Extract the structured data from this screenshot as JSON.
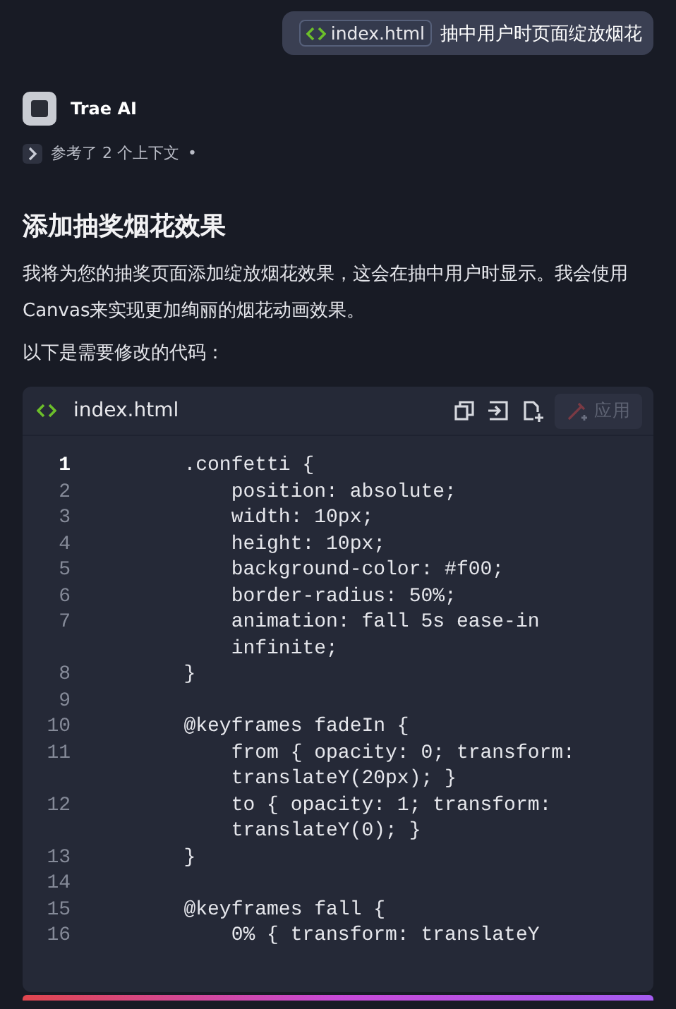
{
  "user_message": {
    "file_chip": "index.html",
    "text": "抽中用户时页面绽放烟花"
  },
  "assistant": {
    "name": "Trae AI",
    "context_note": "参考了 2 个上下文",
    "context_dot": "•"
  },
  "heading": "添加抽奖烟花效果",
  "paragraphs": [
    "我将为您的抽奖页面添加绽放烟花效果，这会在抽中用户时显示。我会使用Canvas来实现更加绚丽的烟花动画效果。",
    "以下是需要修改的代码："
  ],
  "code_block": {
    "filename": "index.html",
    "apply_label": "应用",
    "apply_disabled": true,
    "lines": [
      {
        "number": "1",
        "current": true,
        "text": "        .confetti {"
      },
      {
        "number": "2",
        "current": false,
        "text": "            position: absolute;"
      },
      {
        "number": "3",
        "current": false,
        "text": "            width: 10px;"
      },
      {
        "number": "4",
        "current": false,
        "text": "            height: 10px;"
      },
      {
        "number": "5",
        "current": false,
        "text": "            background-color: #f00;"
      },
      {
        "number": "6",
        "current": false,
        "text": "            border-radius: 50%;"
      },
      {
        "number": "7",
        "current": false,
        "text": "            animation: fall 5s ease-in",
        "continuation": "            infinite;"
      },
      {
        "number": "8",
        "current": false,
        "text": "        }"
      },
      {
        "number": "9",
        "current": false
      },
      {
        "number": "10",
        "current": false,
        "text": "        @keyframes fadeIn {"
      },
      {
        "number": "11",
        "current": false,
        "text": "            from { opacity: 0; transform:",
        "continuation": "            translateY(20px); }"
      },
      {
        "number": "12",
        "current": false,
        "text": "            to { opacity: 1; transform:",
        "continuation": "            translateY(0); }"
      },
      {
        "number": "13",
        "current": false,
        "text": "        }"
      },
      {
        "number": "14",
        "current": false
      },
      {
        "number": "15",
        "current": false,
        "text": "        @keyframes fall {"
      },
      {
        "number": "16",
        "current": false,
        "text": "            0% { transform: translateY"
      }
    ]
  }
}
